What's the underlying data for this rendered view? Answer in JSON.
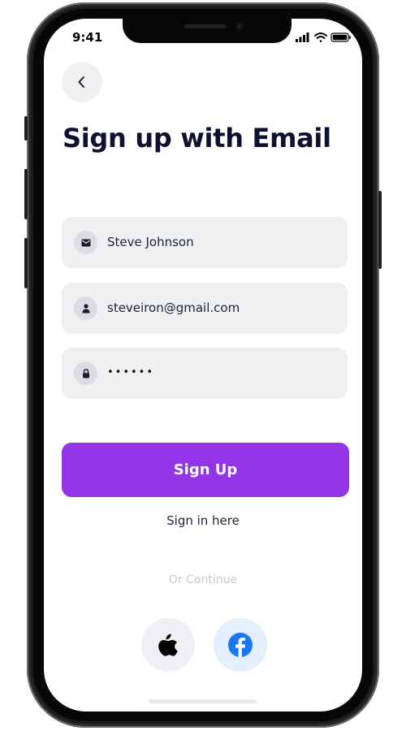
{
  "status_bar": {
    "time": "9:41",
    "icons": [
      "cellular-signal-icon",
      "wifi-icon",
      "battery-icon"
    ]
  },
  "header": {
    "back_icon": "chevron-left-icon",
    "title": "Sign up with Email"
  },
  "form": {
    "fields": [
      {
        "icon": "mail-icon",
        "value": "Steve Johnson"
      },
      {
        "icon": "user-icon",
        "value": "steveiron@gmail.com"
      },
      {
        "icon": "lock-icon",
        "value": "••••••"
      }
    ],
    "submit_label": "Sign Up"
  },
  "signin_link": "Sign in here",
  "divider_text": "Or Continue",
  "social": [
    {
      "icon": "apple-icon"
    },
    {
      "icon": "facebook-icon"
    }
  ],
  "colors": {
    "primary": "#9335e6",
    "title": "#0f1130",
    "field_bg": "#eff0f2",
    "muted": "#c8c9cf",
    "facebook": "#1877f2"
  }
}
